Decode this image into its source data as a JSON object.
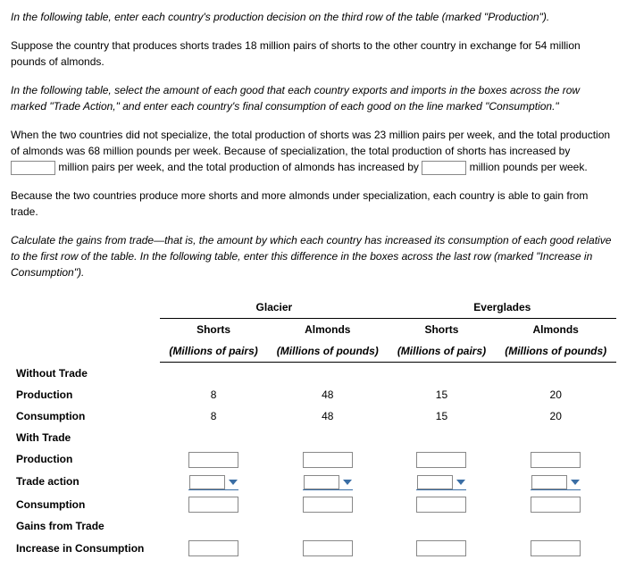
{
  "paragraphs": {
    "p1": "In the following table, enter each country's production decision on the third row of the table (marked \"Production\").",
    "p2": "Suppose the country that produces shorts trades 18 million pairs of shorts to the other country in exchange for 54 million pounds of almonds.",
    "p3": "In the following table, select the amount of each good that each country exports and imports in the boxes across the row marked \"Trade Action,\" and enter each country's final consumption of each good on the line marked \"Consumption.\"",
    "p4_pre": "When the two countries did not specialize, the total production of shorts was 23 million pairs per week, and the total production of almonds was 68 million pounds per week. Because of specialization, the total production of shorts has increased by ",
    "p4_mid": " million pairs per week, and the total production of almonds has increased by ",
    "p4_post": " million pounds per week.",
    "p5": "Because the two countries produce more shorts and more almonds under specialization, each country is able to gain from trade.",
    "p6": "Calculate the gains from trade—that is, the amount by which each country has increased its consumption of each good relative to the first row of the table. In the following table, enter this difference in the boxes across the last row (marked \"Increase in Consumption\")."
  },
  "table": {
    "countries": {
      "c1": "Glacier",
      "c2": "Everglades"
    },
    "goods": {
      "g1": "Shorts",
      "g2": "Almonds"
    },
    "units": {
      "u1": "(Millions of pairs)",
      "u2": "(Millions of pounds)"
    },
    "rows": {
      "without_trade": "Without Trade",
      "production": "Production",
      "consumption": "Consumption",
      "with_trade": "With Trade",
      "trade_action": "Trade action",
      "gains": "Gains from Trade",
      "increase": "Increase in Consumption"
    },
    "without_trade_vals": {
      "production": {
        "c1g1": "8",
        "c1g2": "48",
        "c2g1": "15",
        "c2g2": "20"
      },
      "consumption": {
        "c1g1": "8",
        "c1g2": "48",
        "c2g1": "15",
        "c2g2": "20"
      }
    }
  }
}
